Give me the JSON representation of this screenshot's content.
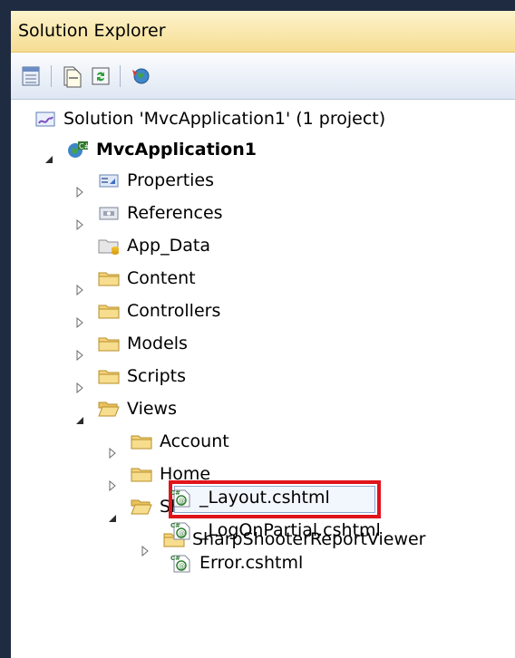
{
  "panel": {
    "title": "Solution Explorer"
  },
  "toolbar": {
    "buttons": [
      "properties-icon",
      "show-all-files-icon",
      "refresh-icon",
      "view-class-diagram-icon"
    ]
  },
  "tree": {
    "solution": "Solution 'MvcApplication1' (1 project)",
    "project": "MvcApplication1",
    "properties": "Properties",
    "references": "References",
    "app_data": "App_Data",
    "content": "Content",
    "controllers": "Controllers",
    "models": "Models",
    "scripts": "Scripts",
    "views": "Views",
    "account": "Account",
    "home": "Home",
    "shared": "Shared",
    "sharpshooter": "SharpShooterReportViewer",
    "layout": "_Layout.cshtml",
    "logon_partial": "_LogOnPartial.cshtml",
    "error": "Error.cshtml"
  },
  "colors": {
    "highlight": "#e0141b",
    "titlebar": "#f6dd92",
    "frame": "#1f2b40"
  }
}
